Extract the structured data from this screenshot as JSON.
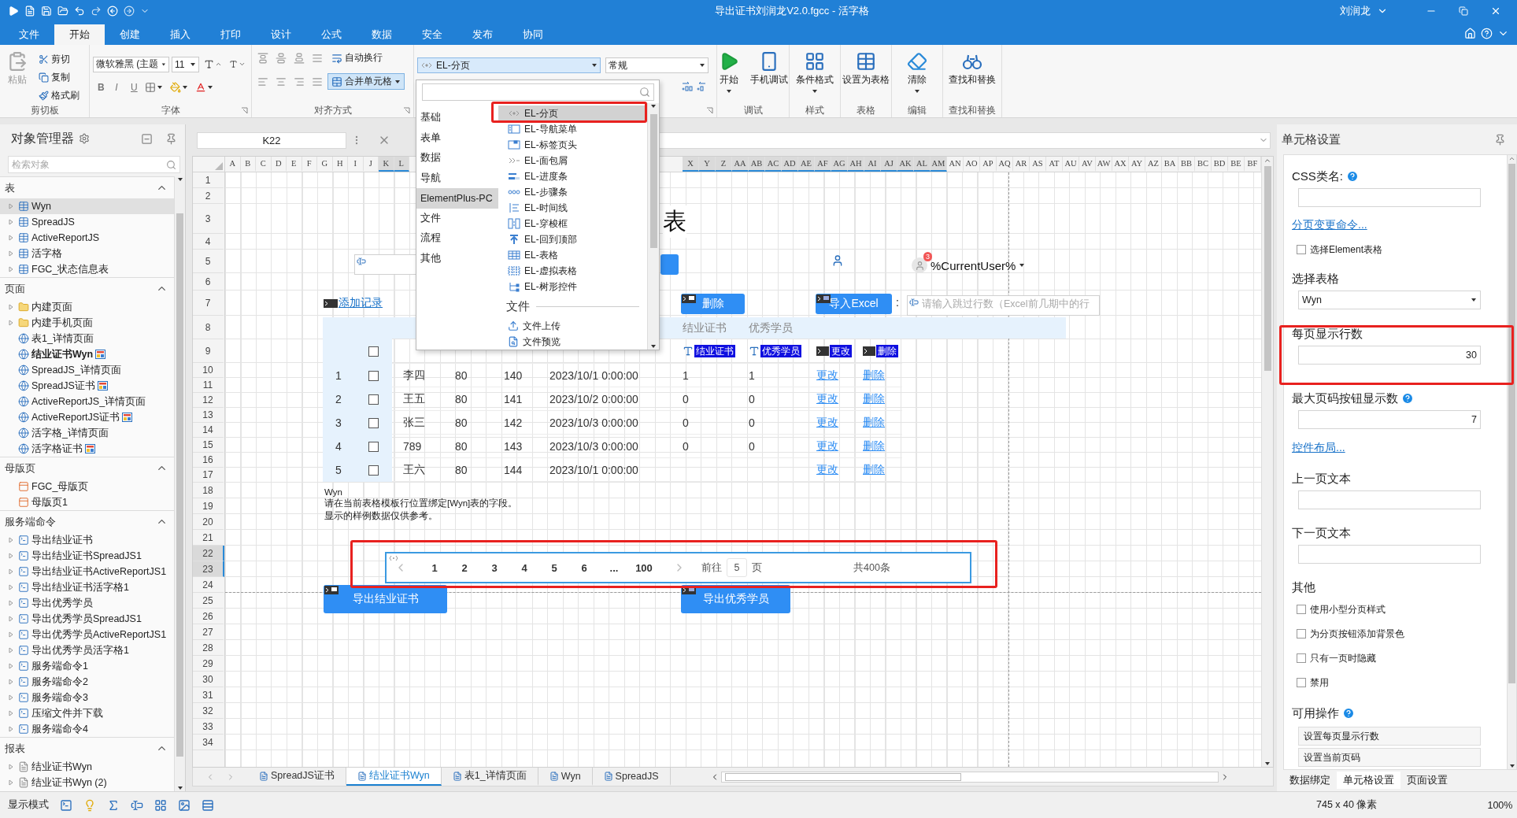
{
  "title_bar": {
    "title": "导出证书刘润龙V2.0.fgcc - 活字格",
    "user": "刘润龙"
  },
  "ribbon_tabs": [
    {
      "label": "文件",
      "selected": false
    },
    {
      "label": "开始",
      "selected": true
    },
    {
      "label": "创建",
      "selected": false
    },
    {
      "label": "插入",
      "selected": false
    },
    {
      "label": "打印",
      "selected": false
    },
    {
      "label": "设计",
      "selected": false
    },
    {
      "label": "公式",
      "selected": false
    },
    {
      "label": "数据",
      "selected": false
    },
    {
      "label": "安全",
      "selected": false
    },
    {
      "label": "发布",
      "selected": false
    },
    {
      "label": "协同",
      "selected": false
    }
  ],
  "ribbon": {
    "clipboard": {
      "paste": "粘贴",
      "cut": "剪切",
      "copy": "复制",
      "painter": "格式刷",
      "label": "剪切板"
    },
    "font": {
      "family": "微软雅黑 (主题",
      "size": "11",
      "bold": "B",
      "italic": "I",
      "underline": "U",
      "label": "字体"
    },
    "alignment": {
      "wrap": "自动换行",
      "merge": "合并单元格",
      "merge_on": true,
      "label": "对齐方式"
    },
    "cell_type": "EL-分页",
    "number_format": "常规",
    "groups": [
      {
        "label": "调试",
        "buttons": [
          {
            "label": "开始",
            "kind": "play",
            "menu": true
          },
          {
            "label": "手机调试",
            "kind": "phone",
            "menu": false
          }
        ]
      },
      {
        "label": "样式",
        "buttons": [
          {
            "label": "条件格式",
            "kind": "grid",
            "menu": true
          }
        ]
      },
      {
        "label": "表格",
        "buttons": [
          {
            "label": "设置为表格",
            "kind": "table",
            "menu": false
          }
        ]
      },
      {
        "label": "编辑",
        "buttons": [
          {
            "label": "清除",
            "kind": "eraser",
            "menu": true
          }
        ]
      },
      {
        "label": "查找和替换",
        "buttons": [
          {
            "label": "查找和替换",
            "kind": "binoculars",
            "menu": false
          }
        ]
      }
    ]
  },
  "object_manager": {
    "title": "对象管理器",
    "search_placeholder": "检索对象",
    "sections": [
      {
        "title": "表",
        "expanded": true,
        "items": [
          {
            "label": "Wyn",
            "kind": "table",
            "expandable": true,
            "selected": true,
            "current": false,
            "badge": false
          },
          {
            "label": "SpreadJS",
            "kind": "table",
            "expandable": true,
            "selected": false,
            "current": false,
            "badge": false
          },
          {
            "label": "ActiveReportJS",
            "kind": "table",
            "expandable": true,
            "selected": false,
            "current": false,
            "badge": false
          },
          {
            "label": "活字格",
            "kind": "table",
            "expandable": true,
            "selected": false,
            "current": false,
            "badge": false
          },
          {
            "label": "FGC_状态信息表",
            "kind": "table",
            "expandable": true,
            "selected": false,
            "current": false,
            "badge": false
          }
        ]
      },
      {
        "title": "页面",
        "expanded": true,
        "items": [
          {
            "label": "内建页面",
            "kind": "folder",
            "expandable": true,
            "selected": false,
            "current": false,
            "badge": false
          },
          {
            "label": "内建手机页面",
            "kind": "folder",
            "expandable": true,
            "selected": false,
            "current": false,
            "badge": false
          },
          {
            "label": "表1_详情页面",
            "kind": "page",
            "expandable": false,
            "selected": false,
            "current": false,
            "badge": false
          },
          {
            "label": "结业证书Wyn",
            "kind": "page",
            "expandable": false,
            "selected": false,
            "current": true,
            "badge": true
          },
          {
            "label": "SpreadJS_详情页面",
            "kind": "page",
            "expandable": false,
            "selected": false,
            "current": false,
            "badge": false
          },
          {
            "label": "SpreadJS证书",
            "kind": "page",
            "expandable": false,
            "selected": false,
            "current": false,
            "badge": true
          },
          {
            "label": "ActiveReportJS_详情页面",
            "kind": "page",
            "expandable": false,
            "selected": false,
            "current": false,
            "badge": false
          },
          {
            "label": "ActiveReportJS证书",
            "kind": "page",
            "expandable": false,
            "selected": false,
            "current": false,
            "badge": true
          },
          {
            "label": "活字格_详情页面",
            "kind": "page",
            "expandable": false,
            "selected": false,
            "current": false,
            "badge": false
          },
          {
            "label": "活字格证书",
            "kind": "page",
            "expandable": false,
            "selected": false,
            "current": false,
            "badge": true
          }
        ]
      },
      {
        "title": "母版页",
        "expanded": true,
        "items": [
          {
            "label": "FGC_母版页",
            "kind": "master",
            "expandable": false,
            "selected": false,
            "current": false,
            "badge": false
          },
          {
            "label": "母版页1",
            "kind": "master",
            "expandable": false,
            "selected": false,
            "current": false,
            "badge": false
          }
        ]
      },
      {
        "title": "服务端命令",
        "expanded": true,
        "items": [
          {
            "label": "导出结业证书",
            "kind": "command",
            "expandable": true,
            "selected": false,
            "current": false,
            "badge": false
          },
          {
            "label": "导出结业证书SpreadJS1",
            "kind": "command",
            "expandable": true,
            "selected": false,
            "current": false,
            "badge": false
          },
          {
            "label": "导出结业证书ActiveReportJS1",
            "kind": "command",
            "expandable": true,
            "selected": false,
            "current": false,
            "badge": false
          },
          {
            "label": "导出结业证书活字格1",
            "kind": "command",
            "expandable": true,
            "selected": false,
            "current": false,
            "badge": false
          },
          {
            "label": "导出优秀学员",
            "kind": "command",
            "expandable": true,
            "selected": false,
            "current": false,
            "badge": false
          },
          {
            "label": "导出优秀学员SpreadJS1",
            "kind": "command",
            "expandable": true,
            "selected": false,
            "current": false,
            "badge": false
          },
          {
            "label": "导出优秀学员ActiveReportJS1",
            "kind": "command",
            "expandable": true,
            "selected": false,
            "current": false,
            "badge": false
          },
          {
            "label": "导出优秀学员活字格1",
            "kind": "command",
            "expandable": true,
            "selected": false,
            "current": false,
            "badge": false
          },
          {
            "label": "服务端命令1",
            "kind": "command",
            "expandable": true,
            "selected": false,
            "current": false,
            "badge": false
          },
          {
            "label": "服务端命令2",
            "kind": "command",
            "expandable": true,
            "selected": false,
            "current": false,
            "badge": false
          },
          {
            "label": "服务端命令3",
            "kind": "command",
            "expandable": true,
            "selected": false,
            "current": false,
            "badge": false
          },
          {
            "label": "压缩文件并下载",
            "kind": "command",
            "expandable": true,
            "selected": false,
            "current": false,
            "badge": false
          },
          {
            "label": "服务端命令4",
            "kind": "command",
            "expandable": true,
            "selected": false,
            "current": false,
            "badge": false
          }
        ]
      },
      {
        "title": "报表",
        "expanded": true,
        "items": [
          {
            "label": "结业证书Wyn",
            "kind": "report",
            "expandable": true,
            "selected": false,
            "current": false,
            "badge": false
          },
          {
            "label": "结业证书Wyn (2)",
            "kind": "report",
            "expandable": true,
            "selected": false,
            "current": false,
            "badge": false
          }
        ]
      }
    ]
  },
  "formula_bar": {
    "cell": "K22"
  },
  "sheet": {
    "columns_left": [
      {
        "label": "A",
        "selected": false
      },
      {
        "label": "B",
        "selected": false
      },
      {
        "label": "C",
        "selected": false
      },
      {
        "label": "D",
        "selected": false
      },
      {
        "label": "E",
        "selected": false
      },
      {
        "label": "F",
        "selected": false
      },
      {
        "label": "G",
        "selected": false
      },
      {
        "label": "H",
        "selected": false
      },
      {
        "label": "I",
        "selected": false
      },
      {
        "label": "J",
        "selected": false
      },
      {
        "label": "K",
        "selected": true
      },
      {
        "label": "L",
        "selected": true
      }
    ],
    "columns_right": [
      {
        "label": "X",
        "selected": true
      },
      {
        "label": "Y",
        "selected": true
      },
      {
        "label": "Z",
        "selected": true
      },
      {
        "label": "AA",
        "selected": true
      },
      {
        "label": "AB",
        "selected": true
      },
      {
        "label": "AC",
        "selected": true
      },
      {
        "label": "AD",
        "selected": true
      },
      {
        "label": "AE",
        "selected": true
      },
      {
        "label": "AF",
        "selected": true
      },
      {
        "label": "AG",
        "selected": true
      },
      {
        "label": "AH",
        "selected": true
      },
      {
        "label": "AI",
        "selected": true
      },
      {
        "label": "AJ",
        "selected": true
      },
      {
        "label": "AK",
        "selected": true
      },
      {
        "label": "AL",
        "selected": true
      },
      {
        "label": "AM",
        "selected": true
      },
      {
        "label": "AN",
        "selected": false
      },
      {
        "label": "AO",
        "selected": false
      },
      {
        "label": "AP",
        "selected": false
      },
      {
        "label": "AQ",
        "selected": false
      },
      {
        "label": "AR",
        "selected": false
      },
      {
        "label": "AS",
        "selected": false
      },
      {
        "label": "AT",
        "selected": false
      },
      {
        "label": "AU",
        "selected": false
      },
      {
        "label": "AV",
        "selected": false
      },
      {
        "label": "AW",
        "selected": false
      },
      {
        "label": "AX",
        "selected": false
      },
      {
        "label": "AY",
        "selected": false
      },
      {
        "label": "AZ",
        "selected": false
      },
      {
        "label": "BA",
        "selected": false
      },
      {
        "label": "BB",
        "selected": false
      },
      {
        "label": "BC",
        "selected": false
      },
      {
        "label": "BD",
        "selected": false
      },
      {
        "label": "BE",
        "selected": false
      },
      {
        "label": "BF",
        "selected": false
      }
    ],
    "rows": [
      {
        "label": "1",
        "selected": false
      },
      {
        "label": "2",
        "selected": false
      },
      {
        "label": "3",
        "selected": false
      },
      {
        "label": "4",
        "selected": false
      },
      {
        "label": "5",
        "selected": false
      },
      {
        "label": "6",
        "selected": false
      },
      {
        "label": "7",
        "selected": false
      },
      {
        "label": "8",
        "selected": false
      },
      {
        "label": "9",
        "selected": false
      },
      {
        "label": "10",
        "selected": false
      },
      {
        "label": "11",
        "selected": false
      },
      {
        "label": "12",
        "selected": false
      },
      {
        "label": "13",
        "selected": false
      },
      {
        "label": "14",
        "selected": false
      },
      {
        "label": "15",
        "selected": false
      },
      {
        "label": "16",
        "selected": false
      },
      {
        "label": "17",
        "selected": false
      },
      {
        "label": "18",
        "selected": false
      },
      {
        "label": "19",
        "selected": false
      },
      {
        "label": "20",
        "selected": false
      },
      {
        "label": "21",
        "selected": false
      },
      {
        "label": "22",
        "selected": true
      },
      {
        "label": "23",
        "selected": true
      },
      {
        "label": "24",
        "selected": false
      },
      {
        "label": "25",
        "selected": false
      },
      {
        "label": "26",
        "selected": false
      },
      {
        "label": "27",
        "selected": false
      },
      {
        "label": "28",
        "selected": false
      },
      {
        "label": "29",
        "selected": false
      },
      {
        "label": "30",
        "selected": false
      },
      {
        "label": "31",
        "selected": false
      },
      {
        "label": "32",
        "selected": false
      },
      {
        "label": "33",
        "selected": false
      },
      {
        "label": "34",
        "selected": false
      }
    ],
    "tabs": [
      {
        "label": "SpreadJS证书",
        "selected": false
      },
      {
        "label": "结业证书Wyn",
        "selected": true
      },
      {
        "label": "表1_详情页面",
        "selected": false
      },
      {
        "label": "Wyn",
        "selected": false
      },
      {
        "label": "SpreadJS",
        "selected": false
      }
    ]
  },
  "canvas": {
    "heading": "表",
    "user_select": {
      "value": "%CurrentUser%",
      "badge": "3"
    },
    "add_link": "添加记录",
    "delete_button": "删除",
    "import_button": "导入Excel",
    "colon": ":",
    "skip_input": {
      "placeholder": "请输入跳过行数（Excel前几期中的行"
    },
    "table": {
      "headers": [
        "结业证书",
        "优秀学员"
      ],
      "template": {
        "checked": false,
        "chips": [
          {
            "label": "结业证书",
            "kind": "field"
          },
          {
            "label": "优秀学员",
            "kind": "field"
          },
          {
            "label": "更改",
            "kind": "command"
          },
          {
            "label": "删除",
            "kind": "command"
          }
        ]
      },
      "rows": [
        {
          "index": "1",
          "checked": false,
          "cells": [
            "李四",
            "80",
            "140",
            "2023/10/1 0:00:00",
            "1",
            "1"
          ],
          "actions": [
            "更改",
            "删除"
          ]
        },
        {
          "index": "2",
          "checked": false,
          "cells": [
            "王五",
            "80",
            "141",
            "2023/10/2 0:00:00",
            "0",
            "0"
          ],
          "actions": [
            "更改",
            "删除"
          ]
        },
        {
          "index": "3",
          "checked": false,
          "cells": [
            "张三",
            "80",
            "142",
            "2023/10/3 0:00:00",
            "0",
            "0"
          ],
          "actions": [
            "更改",
            "删除"
          ]
        },
        {
          "index": "4",
          "checked": false,
          "cells": [
            "789",
            "80",
            "143",
            "2023/10/3 0:00:00",
            "0",
            "0"
          ],
          "actions": [
            "更改",
            "删除"
          ]
        },
        {
          "index": "5",
          "checked": false,
          "cells": [
            "王六",
            "80",
            "144",
            "2023/10/1 0:00:00"
          ],
          "actions": [
            "更改",
            "删除"
          ]
        }
      ]
    },
    "hint": {
      "title": "Wyn",
      "lines": [
        "请在当前表格模板行位置绑定[Wyn]表的字段。",
        "显示的样例数据仅供参考。"
      ]
    },
    "pager": {
      "pages": [
        {
          "label": "1",
          "selected": false
        },
        {
          "label": "2",
          "selected": false
        },
        {
          "label": "3",
          "selected": false
        },
        {
          "label": "4",
          "selected": false
        },
        {
          "label": "5",
          "selected": false
        },
        {
          "label": "6",
          "selected": false
        },
        {
          "label": "...",
          "selected": false
        },
        {
          "label": "100",
          "selected": false
        }
      ],
      "goto_label": "前往",
      "goto_value": "5",
      "goto_suffix": "页",
      "total": "共400条"
    },
    "export_buttons": [
      "导出结业证书",
      "导出优秀学员"
    ]
  },
  "cell_type_menu": {
    "categories": [
      {
        "label": "基础",
        "selected": false
      },
      {
        "label": "表单",
        "selected": false
      },
      {
        "label": "数据",
        "selected": false
      },
      {
        "label": "导航",
        "selected": false
      },
      {
        "label": "ElementPlus-PC",
        "selected": true
      },
      {
        "label": "文件",
        "selected": false
      },
      {
        "label": "流程",
        "selected": false
      },
      {
        "label": "其他",
        "selected": false
      }
    ],
    "items": [
      {
        "label": "EL-分页",
        "kind": "pager",
        "selected": true
      },
      {
        "label": "EL-导航菜单",
        "kind": "menu",
        "selected": false
      },
      {
        "label": "EL-标签页头",
        "kind": "tabs",
        "selected": false
      },
      {
        "label": "EL-面包屑",
        "kind": "breadcrumb",
        "selected": false
      },
      {
        "label": "EL-进度条",
        "kind": "progress",
        "selected": false
      },
      {
        "label": "EL-步骤条",
        "kind": "steps",
        "selected": false
      },
      {
        "label": "EL-时间线",
        "kind": "timeline",
        "selected": false
      },
      {
        "label": "EL-穿梭框",
        "kind": "transfer",
        "selected": false
      },
      {
        "label": "EL-回到顶部",
        "kind": "backtop",
        "selected": false
      },
      {
        "label": "EL-表格",
        "kind": "table",
        "selected": false
      },
      {
        "label": "EL-虚拟表格",
        "kind": "vtable",
        "selected": false
      },
      {
        "label": "EL-树形控件",
        "kind": "tree",
        "selected": false
      }
    ],
    "section": "文件",
    "section_items": [
      {
        "label": "文件上传",
        "kind": "upload",
        "selected": false
      },
      {
        "label": "文件预览",
        "kind": "preview",
        "selected": false
      }
    ]
  },
  "cell_settings": {
    "title": "单元格设置",
    "css_label": "CSS类名:",
    "pager_command_link": "分页变更命令...",
    "element_table": {
      "label": "选择Element表格",
      "checked": false
    },
    "table_label": "选择表格",
    "table_value": "Wyn",
    "rows_label": "每页显示行数",
    "rows_value": "30",
    "max_buttons_label": "最大页码按钮显示数",
    "max_buttons_value": "7",
    "layout_link": "控件布局...",
    "prev_label": "上一页文本",
    "next_label": "下一页文本",
    "other_label": "其他",
    "options": [
      {
        "label": "使用小型分页样式",
        "checked": false
      },
      {
        "label": "为分页按钮添加背景色",
        "checked": false
      },
      {
        "label": "只有一页时隐藏",
        "checked": false
      },
      {
        "label": "禁用",
        "checked": false
      }
    ],
    "actions_label": "可用操作",
    "actions": [
      "设置每页显示行数",
      "设置当前页码"
    ]
  },
  "panel_tabs": [
    {
      "label": "数据绑定",
      "selected": false
    },
    {
      "label": "单元格设置",
      "selected": true
    },
    {
      "label": "页面设置",
      "selected": false
    }
  ],
  "status_bar": {
    "mode_label": "显示模式",
    "size": "745 x 40 像素",
    "zoom": "100%"
  }
}
